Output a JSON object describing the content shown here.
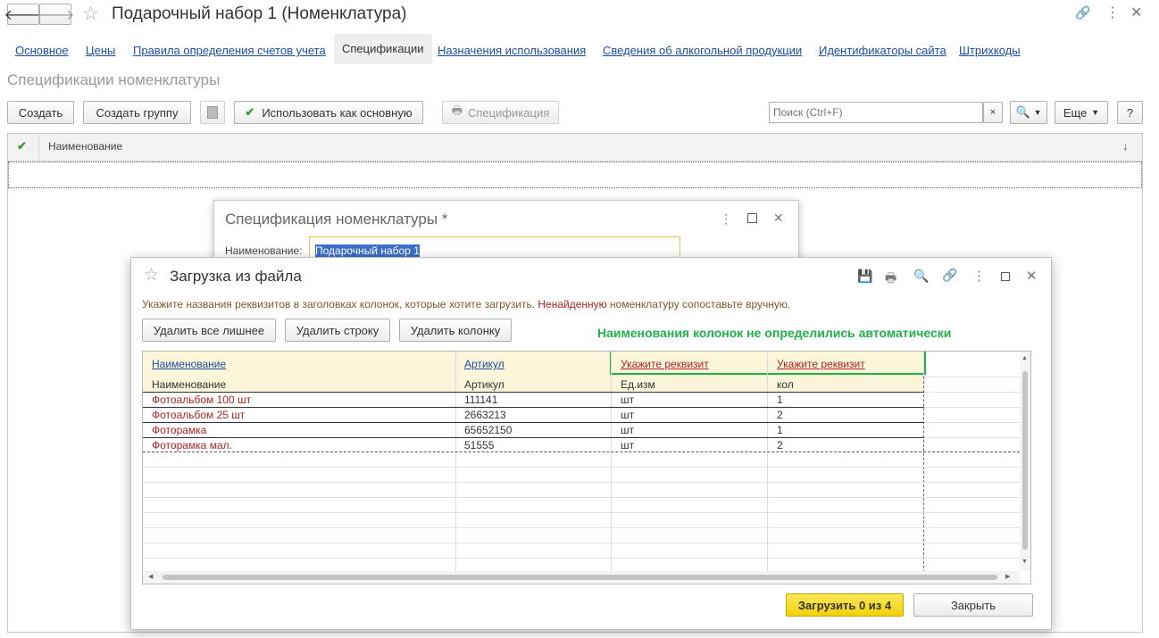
{
  "window": {
    "title": "Подарочный набор 1 (Номенклатура)",
    "back_icon": "arrow-left-icon",
    "forward_icon": "arrow-right-icon"
  },
  "tabs": [
    {
      "label": "Основное"
    },
    {
      "label": "Цены"
    },
    {
      "label": "Правила определения счетов учета"
    },
    {
      "label": "Спецификации"
    },
    {
      "label": "Назначения использования"
    },
    {
      "label": "Сведения об алкогольной продукции"
    },
    {
      "label": "Идентификаторы сайта"
    },
    {
      "label": "Штрихкоды"
    }
  ],
  "section_title": "Спецификации номенклатуры",
  "toolbar": {
    "create": "Создать",
    "create_group": "Создать группу",
    "use_as_main": "Использовать как основную",
    "specification": "Спецификация",
    "search_placeholder": "Поиск (Ctrl+F)",
    "more": "Еще",
    "help": "?"
  },
  "list": {
    "column_name": "Наименование",
    "sort_icon": "↓"
  },
  "spec_dialog": {
    "title": "Спецификация номенклатуры *",
    "name_label": "Наименование:",
    "name_value": "Подарочный набор 1"
  },
  "load_dialog": {
    "title": "Загрузка из файла",
    "hint_part1": "Укажите названия реквизитов в заголовках колонок, которые хотите загрузить.",
    "hint_red": "Ненайденную",
    "hint_part2": "номенклатуру сопоставьте вручную.",
    "btn_delete_extra": "Удалить все лишнее",
    "btn_delete_row": "Удалить строку",
    "btn_delete_column": "Удалить колонку",
    "annotation": "Наименования колонок не определились автоматически",
    "header_links": [
      "Наименование",
      "Артикул",
      "Укажите реквизит",
      "Укажите реквизит"
    ],
    "rows": [
      [
        "Наименование",
        "Артикул",
        "Ед.изм",
        "кол"
      ],
      [
        "Фотоальбом 100 шт",
        "111141",
        "шт",
        "1"
      ],
      [
        "Фотоальбом 25 шт",
        "2663213",
        "шт",
        "2"
      ],
      [
        "Фоторамка",
        "65652150",
        "шт",
        "1"
      ],
      [
        "Фоторамка мал.",
        "51555",
        "шт",
        "2"
      ]
    ],
    "btn_load": "Загрузить 0 из 4",
    "btn_close": "Закрыть"
  }
}
